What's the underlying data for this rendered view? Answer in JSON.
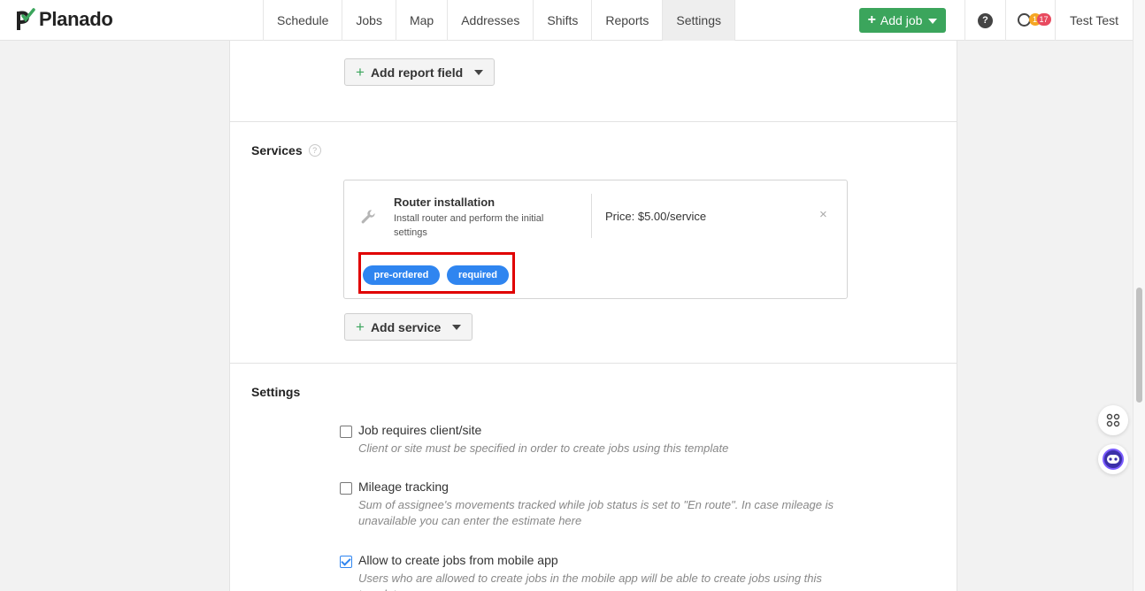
{
  "app": {
    "logo_text": "Planado",
    "user_name": "Test Test"
  },
  "nav": {
    "items": [
      "Schedule",
      "Jobs",
      "Map",
      "Addresses",
      "Shifts",
      "Reports",
      "Settings"
    ],
    "active": "Settings"
  },
  "header": {
    "add_job_label": "Add job",
    "help_symbol": "?",
    "notif_orange": "1",
    "notif_red": "17"
  },
  "report_fields": {
    "add_label": "Add report field"
  },
  "services": {
    "title": "Services",
    "help_symbol": "?",
    "item": {
      "name": "Router installation",
      "description": "Install router and perform the initial settings",
      "price": "Price: $5.00/service",
      "close_symbol": "×",
      "tags": [
        "pre-ordered",
        "required"
      ]
    },
    "add_label": "Add service"
  },
  "settings": {
    "title": "Settings",
    "options": [
      {
        "label": "Job requires client/site",
        "hint": "Client or site must be specified in order to create jobs using this template",
        "checked": false
      },
      {
        "label": "Mileage tracking",
        "hint": "Sum of assignee's movements tracked while job status is set to \"En route\". In case mileage is unavailable you can enter the estimate here",
        "checked": false
      },
      {
        "label": "Allow to create jobs from mobile app",
        "hint": "Users who are allowed to create jobs in the mobile app will be able to create jobs using this template",
        "checked": true
      }
    ]
  },
  "colors": {
    "accent_green": "#3ba55c",
    "tag_blue": "#2f85f0",
    "highlight_red": "#e00000"
  },
  "icons": [
    "logo-check-icon",
    "plus-icon",
    "caret-down-icon",
    "help-icon",
    "clock-icon",
    "wrench-icon",
    "close-icon",
    "apps-grid-icon",
    "chat-bot-icon"
  ]
}
